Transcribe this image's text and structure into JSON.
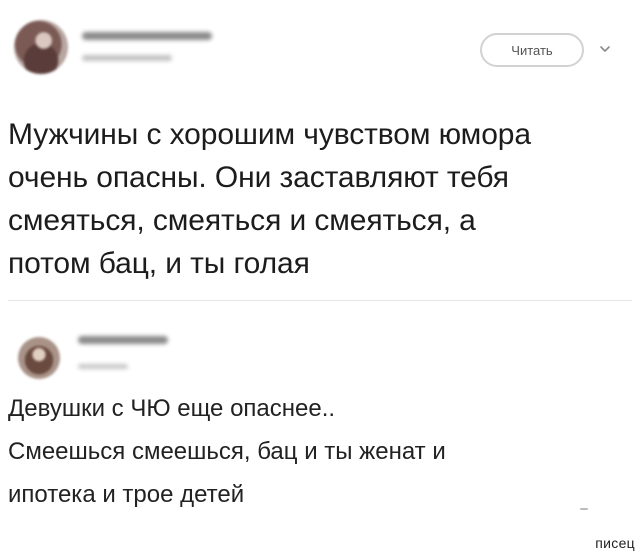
{
  "post1": {
    "follow_button_label": "Читать",
    "text": "Мужчины с хорошим чувством юмора\nочень опасны. Они заставляют тебя\nсмеяться, смеяться и смеяться, а\nпотом бац, и ты голая"
  },
  "post2": {
    "text": "Девушки с ЧЮ еще опаснее..\nСмеешься смеешься, бац и ты женат и\nипотека и трое детей"
  },
  "watermark": "писец",
  "icons": {
    "chevron": "chevron-down-icon"
  }
}
